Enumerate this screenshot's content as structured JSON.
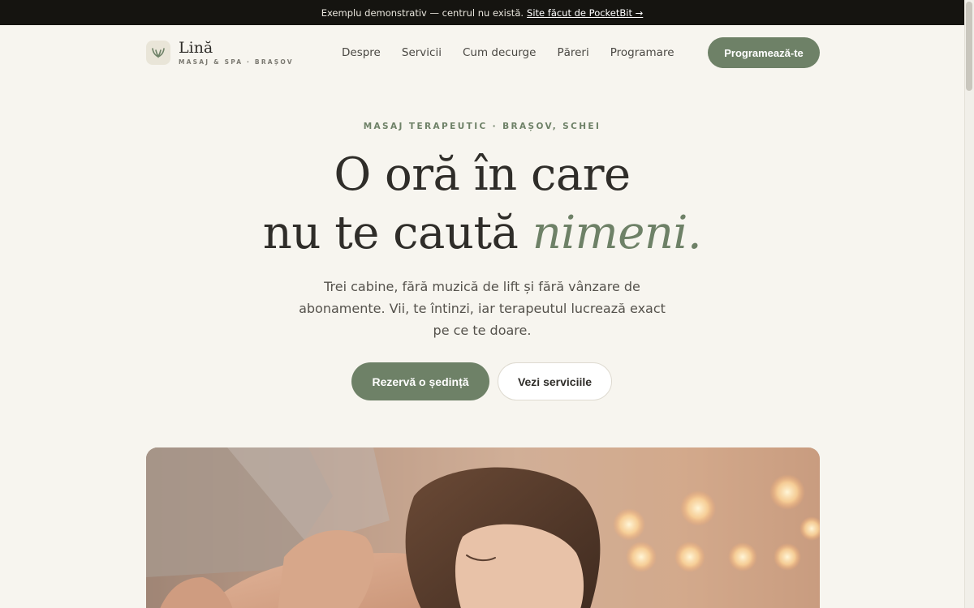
{
  "banner": {
    "text": "Exemplu demonstrativ — centrul nu există.",
    "link": "Site făcut de PocketBit →"
  },
  "brand": {
    "name": "Lină",
    "tagline": "MASAJ & SPA · BRAȘOV"
  },
  "nav": {
    "items": [
      "Despre",
      "Servicii",
      "Cum decurge",
      "Păreri",
      "Programare"
    ],
    "cta": "Programează-te"
  },
  "hero": {
    "eyebrow": "MASAJ TERAPEUTIC · BRAȘOV, SCHEI",
    "headline_line1": "O oră în care",
    "headline_line2_pre": "nu te caută ",
    "headline_line2_accent": "nimeni.",
    "lead": "Trei cabine, fără muzică de lift și fără vânzare de abonamente. Vii, te întinzi, iar terapeutul lucrează exact pe ce te doare.",
    "primary_button": "Rezervă o ședință",
    "secondary_button": "Vezi serviciile"
  },
  "colors": {
    "accent": "#6e8167",
    "background": "#f7f5ef",
    "banner": "#151410",
    "text": "#2f2d29"
  },
  "icons": {
    "logo": "leaf-icon"
  }
}
